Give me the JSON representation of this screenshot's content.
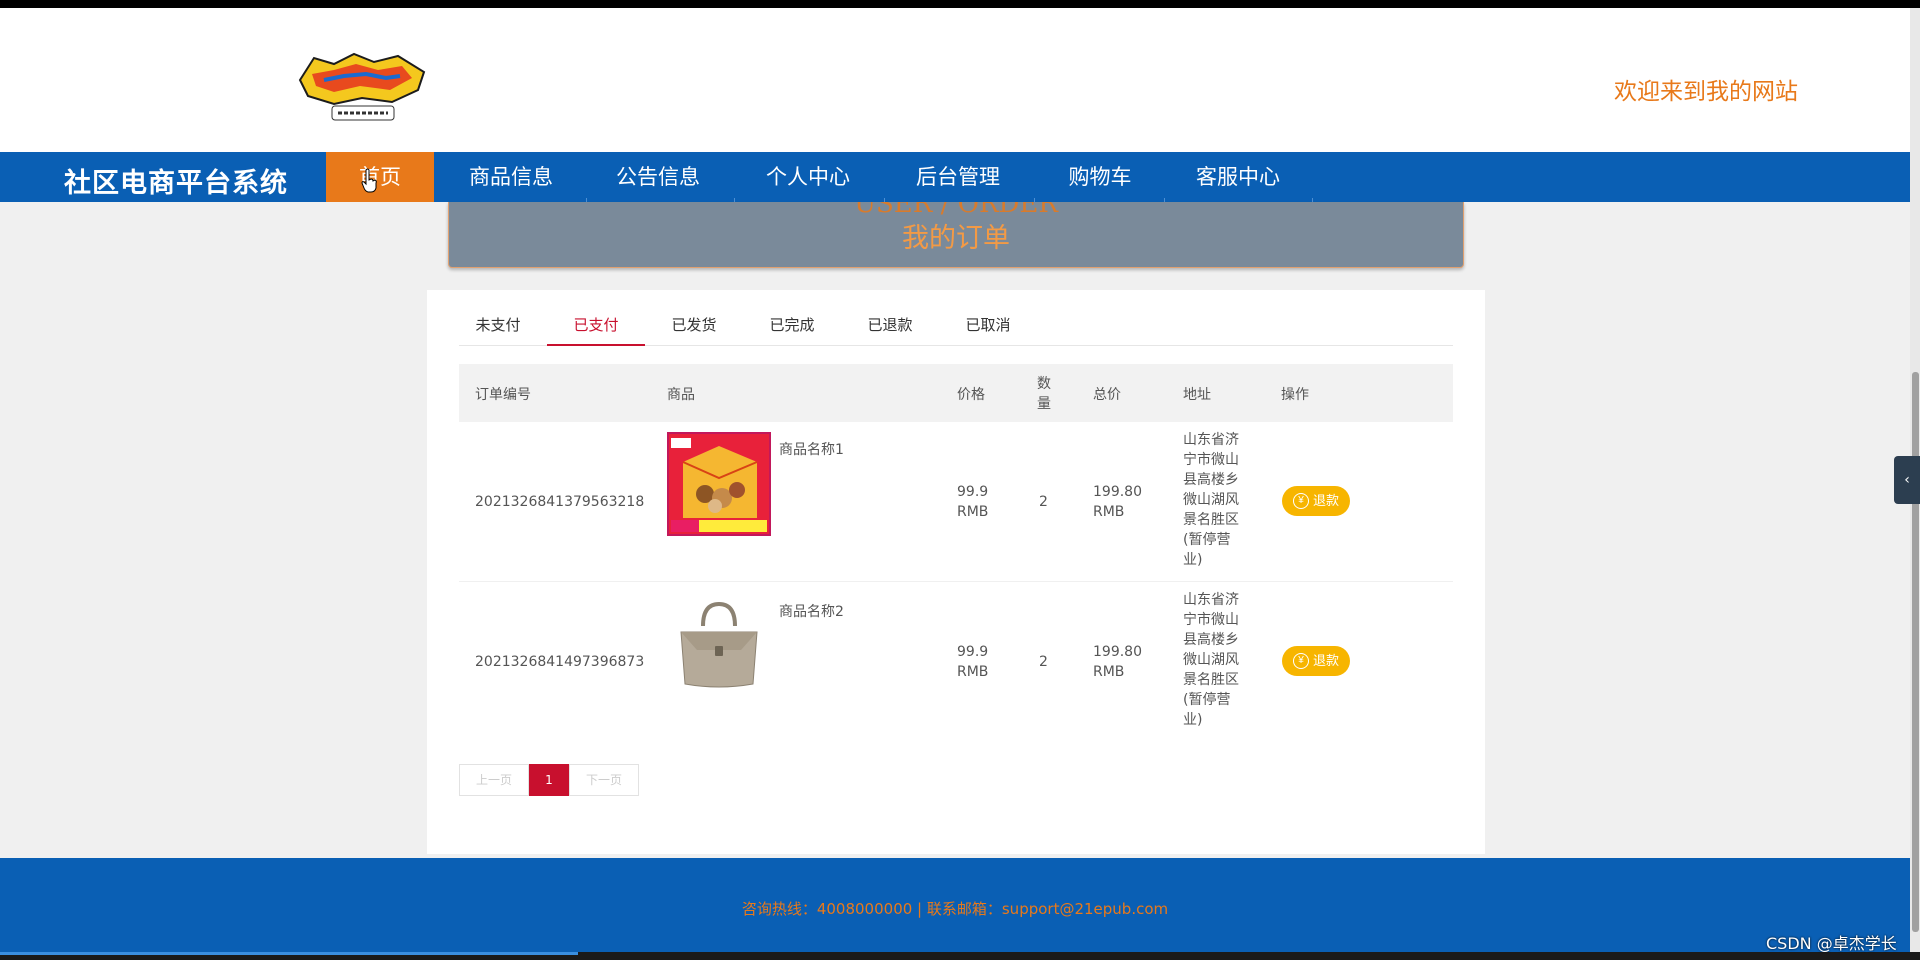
{
  "header": {
    "welcome": "欢迎来到我的网站"
  },
  "nav": {
    "site_title": "社区电商平台系统",
    "items": [
      {
        "label": "首页",
        "active": true
      },
      {
        "label": "商品信息"
      },
      {
        "label": "公告信息"
      },
      {
        "label": "个人中心"
      },
      {
        "label": "后台管理"
      },
      {
        "label": "购物车"
      },
      {
        "label": "客服中心"
      }
    ]
  },
  "banner": {
    "subtitle": "USER / ORDER",
    "title": "我的订单"
  },
  "tabs": [
    {
      "label": "未支付"
    },
    {
      "label": "已支付",
      "active": true
    },
    {
      "label": "已发货"
    },
    {
      "label": "已完成"
    },
    {
      "label": "已退款"
    },
    {
      "label": "已取消"
    }
  ],
  "table": {
    "headers": {
      "order_no": "订单编号",
      "product": "商品",
      "price": "价格",
      "qty": "数量",
      "total": "总价",
      "address": "地址",
      "action": "操作"
    },
    "rows": [
      {
        "order_no": "2021326841379563218",
        "product_name": "商品名称1",
        "product_icon": "snack-box-image",
        "price": "99.9 RMB",
        "qty": "2",
        "total": "199.80 RMB",
        "address": "山东省济宁市微山县高楼乡微山湖风景名胜区(暂停营业)",
        "action": "退款"
      },
      {
        "order_no": "2021326841497396873",
        "product_name": "商品名称2",
        "product_icon": "handbag-image",
        "price": "99.9 RMB",
        "qty": "2",
        "total": "199.80 RMB",
        "address": "山东省济宁市微山县高楼乡微山湖风景名胜区(暂停营业)",
        "action": "退款"
      }
    ]
  },
  "pager": {
    "prev": "上一页",
    "current": "1",
    "next": "下一页"
  },
  "footer": {
    "text": "咨询热线：4008000000 | 联系邮箱：support@21epub.com"
  },
  "watermark": "CSDN @卓杰学长",
  "colors": {
    "nav_blue": "#0a5fb4",
    "accent_orange": "#e8791a",
    "active_red": "#c8102e",
    "button_yellow": "#f7b500"
  }
}
